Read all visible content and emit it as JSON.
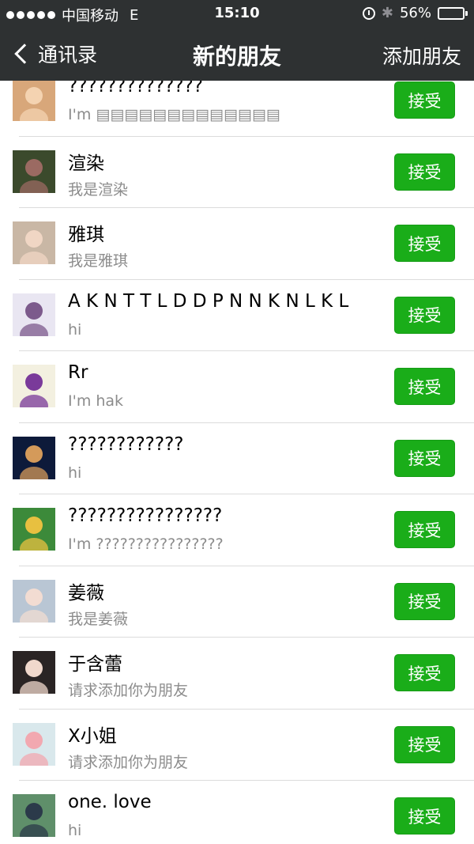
{
  "status": {
    "carrier": "中国移动",
    "network": "E",
    "time": "15:10",
    "battery": "56%",
    "battery_level": 0.56
  },
  "nav": {
    "back_label": "通讯录",
    "title": "新的朋友",
    "action_label": "添加朋友"
  },
  "items": [
    {
      "name": "??????????????",
      "sub": "I'm ▤▤▤▤▤▤▤▤▤▤▤▤▤",
      "button": "接受",
      "avatar_bg": "#d8a77a",
      "avatar_fg": "#f4d3b1"
    },
    {
      "name": "渲染",
      "sub": "我是渲染",
      "button": "接受",
      "avatar_bg": "#3b4a2c",
      "avatar_fg": "#9b6a62"
    },
    {
      "name": "雅琪",
      "sub": "我是雅琪",
      "button": "接受",
      "avatar_bg": "#c9b7a5",
      "avatar_fg": "#f0d6c4"
    },
    {
      "name": "A K N T T L D D P N N K N L K L",
      "sub": "hi",
      "button": "接受",
      "avatar_bg": "#e9e6f2",
      "avatar_fg": "#7c5a8c"
    },
    {
      "name": "Rr",
      "sub": "I'm hak",
      "button": "接受",
      "avatar_bg": "#f3f0e0",
      "avatar_fg": "#7a3a9a"
    },
    {
      "name": "????????????",
      "sub": "hi",
      "button": "接受",
      "avatar_bg": "#0d1a3a",
      "avatar_fg": "#d49a5a"
    },
    {
      "name": "????????????????",
      "sub": "I'm ????????????????",
      "button": "接受",
      "avatar_bg": "#3c8a3a",
      "avatar_fg": "#e8c040"
    },
    {
      "name": "姜薇",
      "sub": "我是姜薇",
      "button": "接受",
      "avatar_bg": "#b9c6d4",
      "avatar_fg": "#f2dcd2"
    },
    {
      "name": "于含蕾",
      "sub": "请求添加你为朋友",
      "button": "接受",
      "avatar_bg": "#2a2424",
      "avatar_fg": "#f0d8cc"
    },
    {
      "name": "X小姐",
      "sub": "请求添加你为朋友",
      "button": "接受",
      "avatar_bg": "#d9e8ec",
      "avatar_fg": "#f2a8b0"
    },
    {
      "name": "one.  love",
      "sub": "hi",
      "button": "接受",
      "avatar_bg": "#5f8f6a",
      "avatar_fg": "#2b3a4a"
    }
  ],
  "colors": {
    "nav_bg": "#2e3132",
    "accept_bg": "#1aad19",
    "sub_text": "#8c8c8c"
  }
}
